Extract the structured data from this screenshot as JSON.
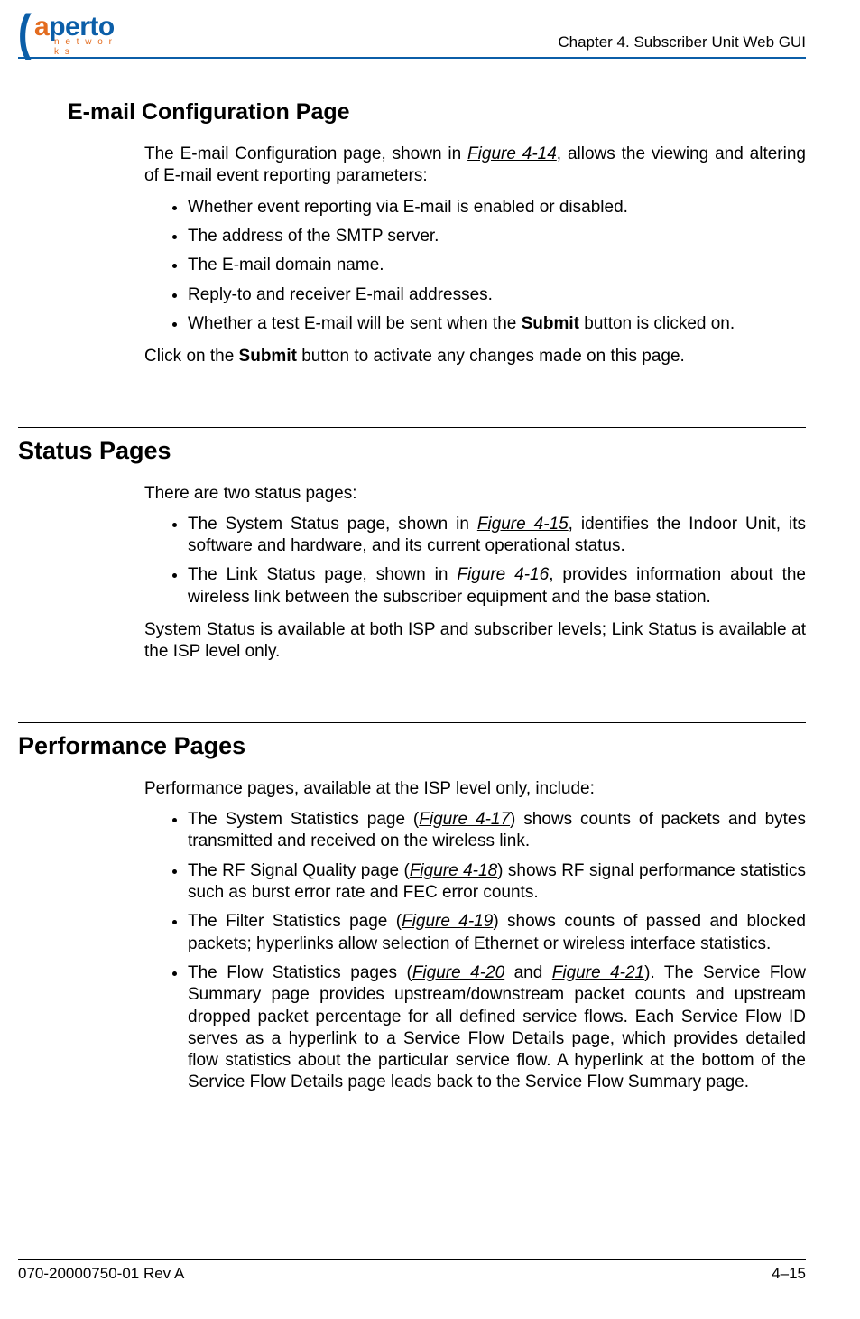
{
  "header": {
    "chapter_label": "Chapter 4.  Subscriber Unit Web GUI",
    "logo_word_part1": "a",
    "logo_word_part2": "perto",
    "logo_tagline": "n e t w o r k s"
  },
  "sections": {
    "email": {
      "heading": "E-mail Configuration Page",
      "intro_pre": "The E-mail Configuration page, shown in ",
      "intro_fig": "Figure 4-14",
      "intro_post": ", allows the viewing and altering of E-mail event reporting parameters:",
      "bullets": [
        {
          "text": "Whether event reporting via E-mail is enabled or disabled."
        },
        {
          "text": "The address of the SMTP server."
        },
        {
          "text": "The E-mail domain name."
        },
        {
          "text": "Reply-to and receiver E-mail addresses."
        },
        {
          "pre": "Whether a test E-mail will be sent when the ",
          "bold": "Submit",
          "post": " button is clicked on."
        }
      ],
      "outro_pre": "Click on the ",
      "outro_bold": "Submit",
      "outro_post": " button to activate any changes made on this page."
    },
    "status": {
      "heading": "Status Pages",
      "intro": "There are two status pages:",
      "b1_pre": "The System Status page, shown in ",
      "b1_fig": "Figure 4-15",
      "b1_post": ", identifies the Indoor Unit, its software and hardware, and its current operational status.",
      "b2_pre": "The Link Status page, shown in ",
      "b2_fig": "Figure 4-16",
      "b2_post": ", provides information about the wireless link between the subscriber equipment and the base station.",
      "outro": "System Status is available at both ISP and subscriber levels; Link Status is available at the ISP level only."
    },
    "perf": {
      "heading": "Performance Pages",
      "intro": "Performance pages, available at the ISP level only, include:",
      "b1_pre": "The System Statistics page (",
      "b1_fig": "Figure 4-17",
      "b1_post": ") shows counts of packets and bytes transmitted and received on the wireless link.",
      "b2_pre": "The RF Signal Quality page (",
      "b2_fig": "Figure 4-18",
      "b2_post": ") shows RF signal performance statistics such as burst error rate and FEC error counts.",
      "b3_pre": "The Filter Statistics page (",
      "b3_fig": "Figure 4-19",
      "b3_post": ") shows counts of passed and blocked packets; hyperlinks allow selection of Ethernet or wireless interface statistics.",
      "b4_pre": "The Flow Statistics pages (",
      "b4_fig1": "Figure 4-20",
      "b4_mid": " and ",
      "b4_fig2": "Figure 4-21",
      "b4_post": "). The Service Flow Summary page provides upstream/downstream packet counts and upstream dropped packet percentage for all defined service flows. Each Service Flow ID serves as a hyperlink to a Service Flow Details page, which provides detailed flow statistics about the particular service flow. A hyperlink at the bottom of the Service Flow Details page leads back to the Service Flow Summary page."
    }
  },
  "footer": {
    "doc_number": "070-20000750-01 Rev A",
    "page_number": "4–15"
  }
}
